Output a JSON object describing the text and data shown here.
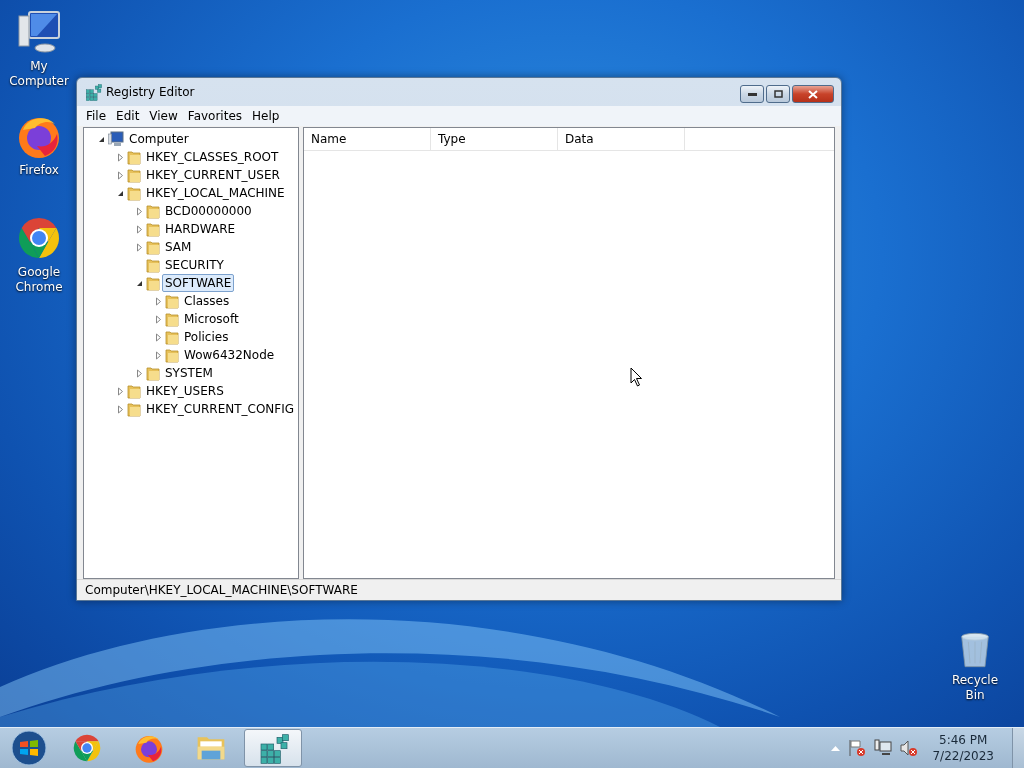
{
  "desktop_icons": [
    {
      "label": "My Computer",
      "kind": "computer"
    },
    {
      "label": "Firefox",
      "kind": "firefox"
    },
    {
      "label": "Google Chrome",
      "kind": "chrome"
    },
    {
      "label": "Recycle Bin",
      "kind": "recycle"
    }
  ],
  "window": {
    "title": "Registry Editor",
    "menu": [
      "File",
      "Edit",
      "View",
      "Favorites",
      "Help"
    ],
    "tree": [
      {
        "label": "Computer",
        "kind": "computer",
        "expanded": true,
        "selected": false,
        "children": [
          {
            "label": "HKEY_CLASSES_ROOT",
            "kind": "folder",
            "expanded": false,
            "selected": false
          },
          {
            "label": "HKEY_CURRENT_USER",
            "kind": "folder",
            "expanded": false,
            "selected": false
          },
          {
            "label": "HKEY_LOCAL_MACHINE",
            "kind": "folder",
            "expanded": true,
            "selected": false,
            "children": [
              {
                "label": "BCD00000000",
                "kind": "folder",
                "expanded": false,
                "selected": false
              },
              {
                "label": "HARDWARE",
                "kind": "folder",
                "expanded": false,
                "selected": false
              },
              {
                "label": "SAM",
                "kind": "folder",
                "expanded": false,
                "selected": false
              },
              {
                "label": "SECURITY",
                "kind": "leaf",
                "selected": false
              },
              {
                "label": "SOFTWARE",
                "kind": "folder",
                "expanded": true,
                "selected": true,
                "children": [
                  {
                    "label": "Classes",
                    "kind": "folder",
                    "expanded": false,
                    "selected": false
                  },
                  {
                    "label": "Microsoft",
                    "kind": "folder",
                    "expanded": false,
                    "selected": false
                  },
                  {
                    "label": "Policies",
                    "kind": "folder",
                    "expanded": false,
                    "selected": false
                  },
                  {
                    "label": "Wow6432Node",
                    "kind": "folder",
                    "expanded": false,
                    "selected": false
                  }
                ]
              },
              {
                "label": "SYSTEM",
                "kind": "folder",
                "expanded": false,
                "selected": false
              }
            ]
          },
          {
            "label": "HKEY_USERS",
            "kind": "folder",
            "expanded": false,
            "selected": false
          },
          {
            "label": "HKEY_CURRENT_CONFIG",
            "kind": "folder",
            "expanded": false,
            "selected": false
          }
        ]
      }
    ],
    "columns": [
      "Name",
      "Type",
      "Data"
    ],
    "status_bar": "Computer\\HKEY_LOCAL_MACHINE\\SOFTWARE"
  },
  "taskbar": {
    "apps": [
      {
        "kind": "chrome",
        "selected": false
      },
      {
        "kind": "firefox",
        "selected": false
      },
      {
        "kind": "explorer",
        "selected": false
      },
      {
        "kind": "regedit",
        "selected": true
      }
    ],
    "clock": {
      "time": "5:46 PM",
      "date": "7/22/2023"
    }
  }
}
